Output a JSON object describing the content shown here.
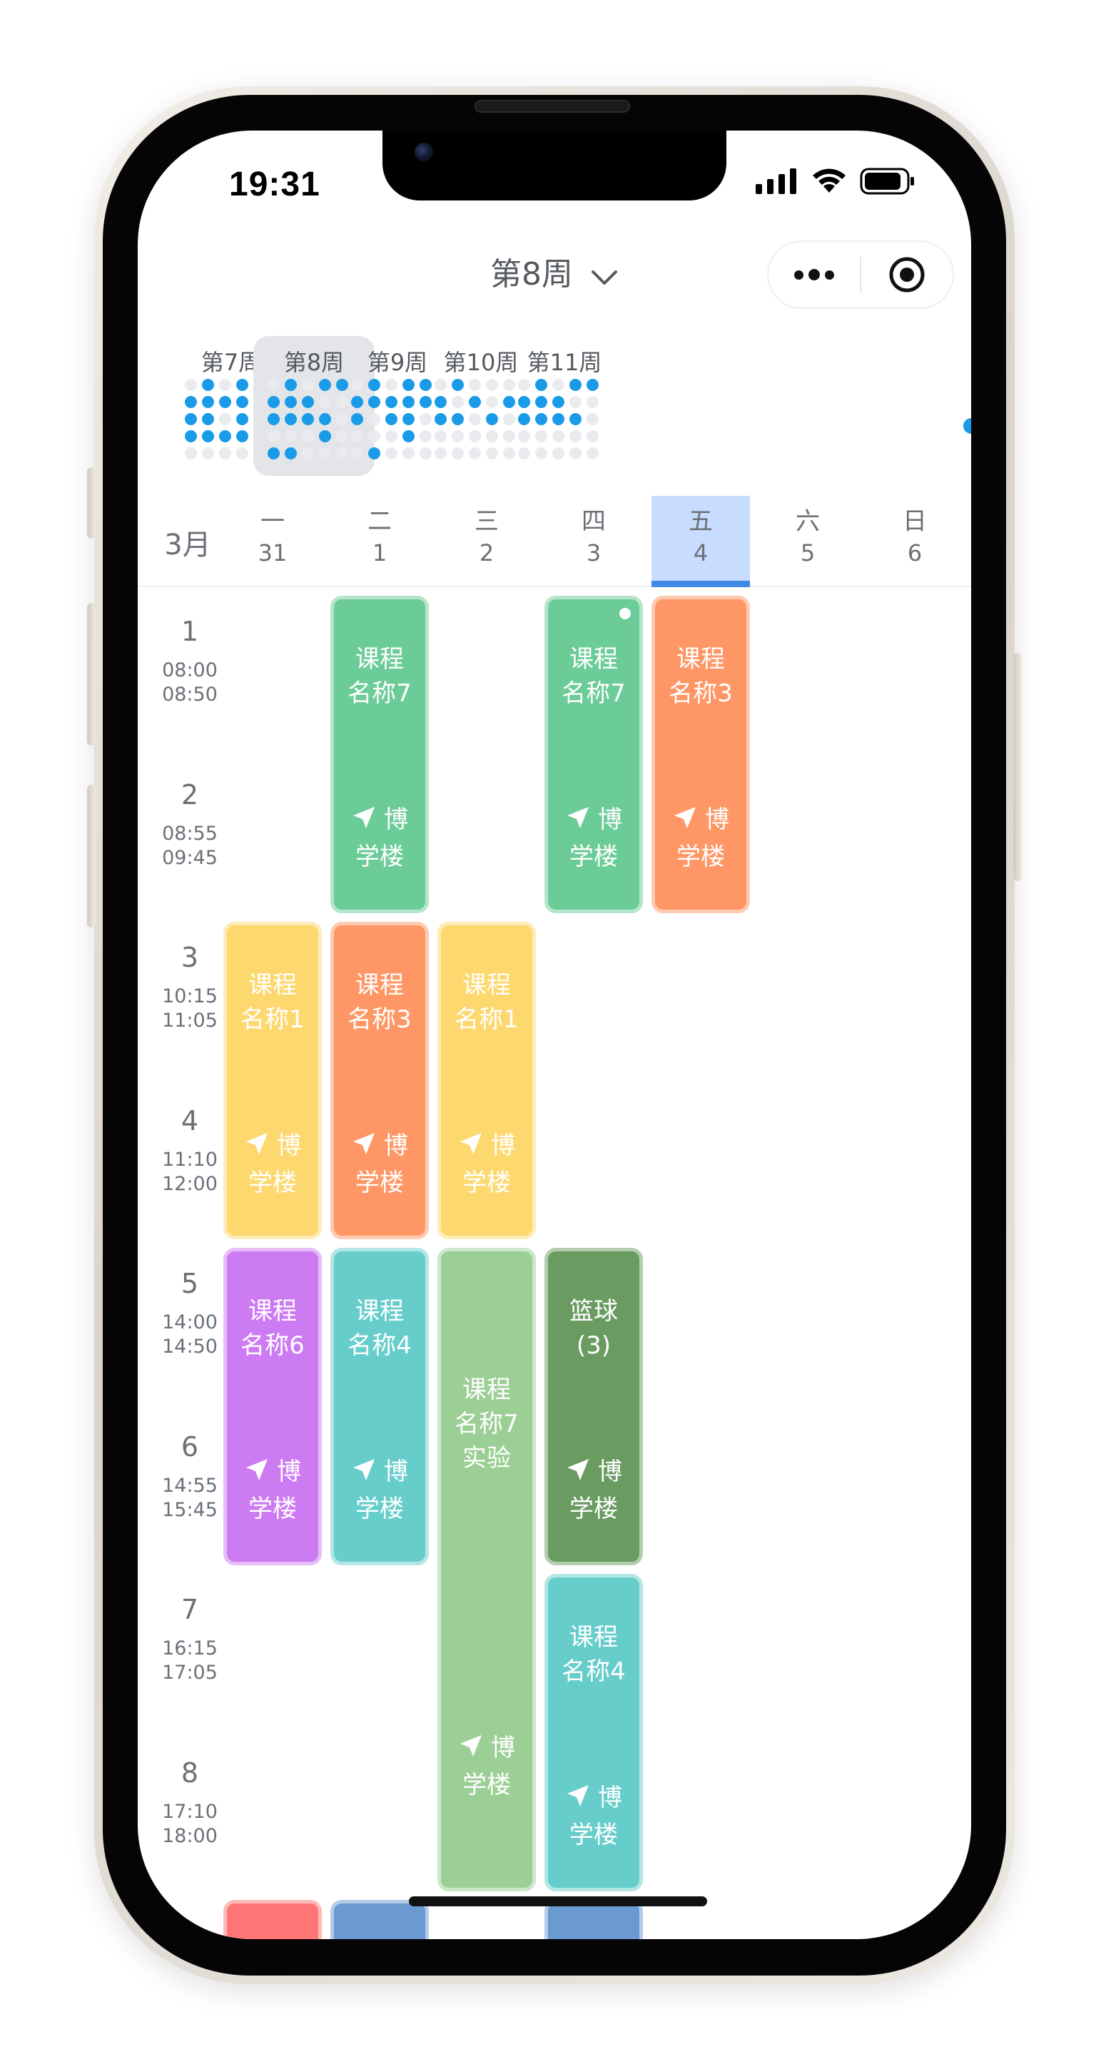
{
  "status_bar": {
    "time": "19:31"
  },
  "nav": {
    "title": "第8周"
  },
  "weeks": [
    {
      "label": "第7周",
      "selected": false,
      "grid": [
        0,
        1,
        0,
        1,
        1,
        1,
        1,
        1,
        1,
        1,
        1,
        1,
        0,
        1,
        0,
        1,
        1,
        1,
        1,
        0,
        0,
        0,
        0,
        0,
        0
      ]
    },
    {
      "label": "第8周",
      "selected": true,
      "grid": [
        0,
        1,
        0,
        1,
        1,
        1,
        1,
        1,
        0,
        0,
        1,
        1,
        1,
        1,
        0,
        0,
        0,
        0,
        1,
        0,
        1,
        1,
        0,
        0,
        0
      ]
    },
    {
      "label": "第9周",
      "selected": false,
      "grid": [
        0,
        1,
        0,
        1,
        1,
        1,
        1,
        1,
        1,
        1,
        1,
        0,
        1,
        1,
        0,
        0,
        0,
        0,
        1,
        0,
        0,
        1,
        0,
        0,
        0
      ]
    },
    {
      "label": "第10周",
      "selected": false,
      "grid": [
        0,
        1,
        0,
        0,
        0,
        1,
        0,
        1,
        0,
        1,
        1,
        1,
        0,
        1,
        0,
        0,
        0,
        0,
        0,
        0,
        0,
        0,
        0,
        0,
        0
      ]
    },
    {
      "label": "第11周",
      "selected": false,
      "grid": [
        0,
        1,
        0,
        1,
        1,
        1,
        1,
        1,
        0,
        0,
        1,
        1,
        1,
        1,
        0,
        0,
        0,
        0,
        0,
        0,
        0,
        0,
        0,
        0,
        0
      ]
    }
  ],
  "month": "3月",
  "days": [
    {
      "name": "一",
      "date": "31",
      "today": false
    },
    {
      "name": "二",
      "date": "1",
      "today": false
    },
    {
      "name": "三",
      "date": "2",
      "today": false
    },
    {
      "name": "四",
      "date": "3",
      "today": false
    },
    {
      "name": "五",
      "date": "4",
      "today": true
    },
    {
      "name": "六",
      "date": "5",
      "today": false
    },
    {
      "name": "日",
      "date": "6",
      "today": false
    }
  ],
  "periods": [
    {
      "num": "1",
      "start": "08:00",
      "end": "08:50"
    },
    {
      "num": "2",
      "start": "08:55",
      "end": "09:45"
    },
    {
      "num": "3",
      "start": "10:15",
      "end": "11:05"
    },
    {
      "num": "4",
      "start": "11:10",
      "end": "12:00"
    },
    {
      "num": "5",
      "start": "14:00",
      "end": "14:50"
    },
    {
      "num": "6",
      "start": "14:55",
      "end": "15:45"
    },
    {
      "num": "7",
      "start": "16:15",
      "end": "17:05"
    },
    {
      "num": "8",
      "start": "17:10",
      "end": "18:00"
    }
  ],
  "courses": [
    {
      "day": 1,
      "start": 1,
      "span": 2,
      "lines": [
        "课程",
        "名称7"
      ],
      "loc": [
        "博",
        "学楼"
      ],
      "color": "#6ccc98",
      "border": "#b5e6cb",
      "marked": false
    },
    {
      "day": 3,
      "start": 1,
      "span": 2,
      "lines": [
        "课程",
        "名称7"
      ],
      "loc": [
        "博",
        "学楼"
      ],
      "color": "#6ccc98",
      "border": "#b5e6cb",
      "marked": true
    },
    {
      "day": 4,
      "start": 1,
      "span": 2,
      "lines": [
        "课程",
        "名称3"
      ],
      "loc": [
        "博",
        "学楼"
      ],
      "color": "#fe9765",
      "border": "#fecbb2",
      "marked": false
    },
    {
      "day": 0,
      "start": 3,
      "span": 2,
      "lines": [
        "课程",
        "名称1"
      ],
      "loc": [
        "博",
        "学楼"
      ],
      "color": "#fdd86f",
      "border": "#feecb7",
      "marked": false
    },
    {
      "day": 1,
      "start": 3,
      "span": 2,
      "lines": [
        "课程",
        "名称3"
      ],
      "loc": [
        "博",
        "学楼"
      ],
      "color": "#fe9765",
      "border": "#fecbb2",
      "marked": false
    },
    {
      "day": 2,
      "start": 3,
      "span": 2,
      "lines": [
        "课程",
        "名称1"
      ],
      "loc": [
        "博",
        "学楼"
      ],
      "color": "#fdd86f",
      "border": "#feecb7",
      "marked": false
    },
    {
      "day": 0,
      "start": 5,
      "span": 2,
      "lines": [
        "课程",
        "名称6"
      ],
      "loc": [
        "博",
        "学楼"
      ],
      "color": "#cd7bf2",
      "border": "#e6bdf8",
      "marked": false
    },
    {
      "day": 1,
      "start": 5,
      "span": 2,
      "lines": [
        "课程",
        "名称4"
      ],
      "loc": [
        "博",
        "学楼"
      ],
      "color": "#67cdcb",
      "border": "#b3e6e5",
      "marked": false
    },
    {
      "day": 2,
      "start": 5,
      "span": 4,
      "lines": [
        "课程",
        "名称7",
        "实验"
      ],
      "loc": [
        "博",
        "学楼"
      ],
      "color": "#9ccf96",
      "border": "#cde7ca",
      "marked": false
    },
    {
      "day": 3,
      "start": 5,
      "span": 2,
      "lines": [
        "篮球",
        "(3)"
      ],
      "loc": [
        "博",
        "学楼"
      ],
      "color": "#6a9b61",
      "border": "#b4cdb0",
      "marked": false
    },
    {
      "day": 3,
      "start": 7,
      "span": 2,
      "lines": [
        "课程",
        "名称4"
      ],
      "loc": [
        "博",
        "学楼"
      ],
      "color": "#67cdcb",
      "border": "#b3e6e5",
      "marked": false
    },
    {
      "day": 0,
      "start": 9,
      "span": 2,
      "lines": [],
      "loc": [],
      "color": "#fe7575",
      "border": "#feb9b9",
      "marked": false
    },
    {
      "day": 1,
      "start": 9,
      "span": 2,
      "lines": [],
      "loc": [],
      "color": "#6a9ad0",
      "border": "#b4cce7",
      "marked": false
    },
    {
      "day": 3,
      "start": 9,
      "span": 2,
      "lines": [],
      "loc": [],
      "color": "#6a9ad0",
      "border": "#b4cce7",
      "marked": false
    }
  ]
}
